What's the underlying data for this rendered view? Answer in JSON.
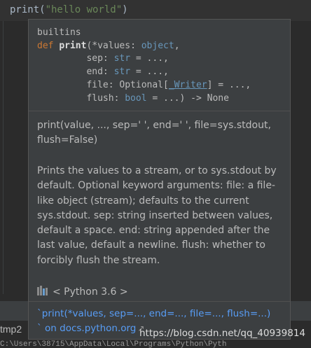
{
  "editor": {
    "code_fn": "print(",
    "code_str": "\"hello world\"",
    "code_end": ")"
  },
  "popup": {
    "module": "builtins",
    "sig_def": "def",
    "sig_name": "print",
    "sig_line1_rest": "(*values: ",
    "sig_line1_type": "object",
    "sig_line1_end": ",",
    "sig_sep_label": "         sep: ",
    "sig_sep_type": "str",
    "sig_sep_rest": " = ...,",
    "sig_end_label": "         end: ",
    "sig_end_type": "str",
    "sig_end_rest": " = ...,",
    "sig_file_label": "         file: Optional[",
    "sig_file_type": "_Writer",
    "sig_file_rest": "] = ...,",
    "sig_flush_label": "         flush: ",
    "sig_flush_type": "bool",
    "sig_flush_rest": " = ...) -> None",
    "short_doc": "print(value, ..., sep=' ', end=' ', file=sys.stdout, flush=False)",
    "long_doc": "Prints the values to a stream, or to sys.stdout by default. Optional keyword arguments: file: a file-like object (stream); defaults to the current sys.stdout. sep: string inserted between values, default a space. end: string appended after the last value, default a newline. flush: whether to forcibly flush the stream.",
    "python_version": "< Python 3.6 >",
    "link_signature": "`print(*values, sep=..., end=..., file=..., flush=...)",
    "link_docs": "` on docs.python.org"
  },
  "bottom": {
    "tab_label": "tmp2",
    "path_text": "C:\\Users\\38715\\AppData\\Local\\Programs\\Python\\Pyth"
  },
  "watermark": "https://blog.csdn.net/qq_40939814",
  "colors": {
    "background": "#2b2b2b",
    "popup_bg": "#3c3f41",
    "link": "#589df6",
    "keyword": "#cc7832",
    "type": "#6897bb",
    "string": "#6a8759"
  }
}
